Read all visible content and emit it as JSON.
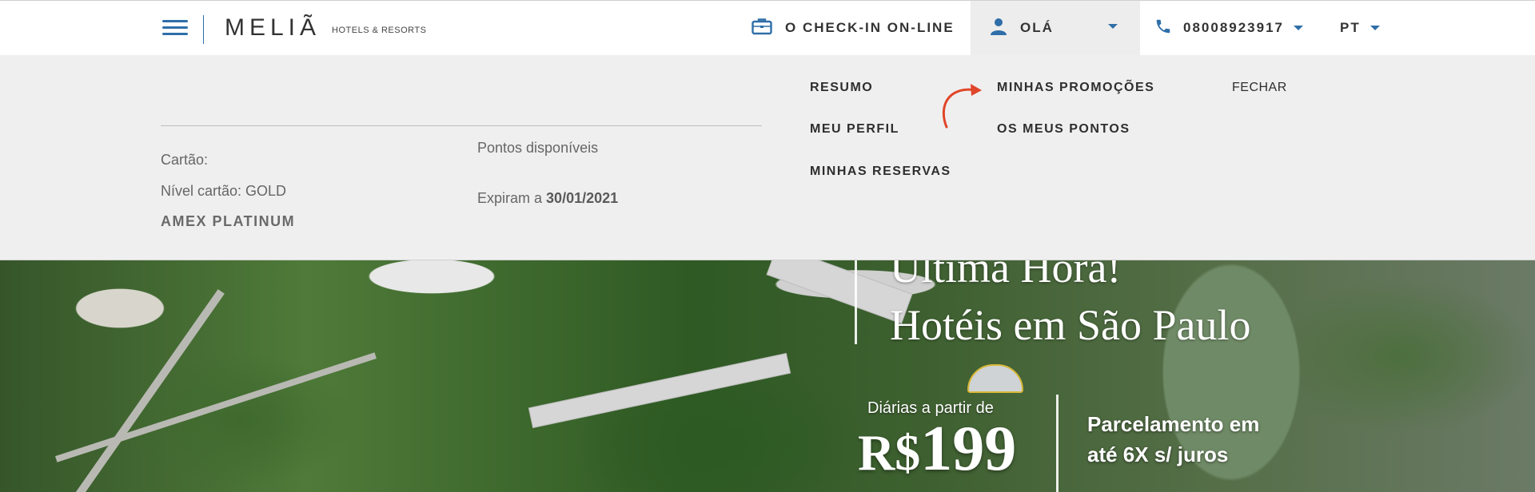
{
  "header": {
    "brand": "MELIÃ",
    "brand_sub": "HOTELS & RESORTS",
    "checkin_label": "O CHECK-IN ON-LINE",
    "user_label": "OLÁ",
    "phone": "08008923917",
    "language": "PT"
  },
  "panel": {
    "card_label": "Cartão:",
    "card_level": "Nível cartão: GOLD",
    "card_name": "AMEX PLATINUM",
    "points_label": "Pontos disponíveis",
    "expire_prefix": "Expiram a",
    "expire_date": "30/01/2021",
    "menu": {
      "resumo": "RESUMO",
      "perfil": "MEU PERFIL",
      "reservas": "MINHAS RESERVAS",
      "promocoes": "MINHAS PROMOÇÕES",
      "pontos": "OS MEUS PONTOS",
      "fechar": "FECHAR"
    }
  },
  "hero": {
    "title_line1": "Última Hora!",
    "title_line2": "Hotéis em São Paulo",
    "diarias": "Diárias a partir de",
    "currency": "R$",
    "price": "199",
    "parcelamento_line1": "Parcelamento em",
    "parcelamento_line2": "até 6X s/ juros"
  },
  "colors": {
    "accent": "#2f6ea8",
    "panel_bg": "#efefef",
    "annotation_arrow": "#e0462a"
  }
}
